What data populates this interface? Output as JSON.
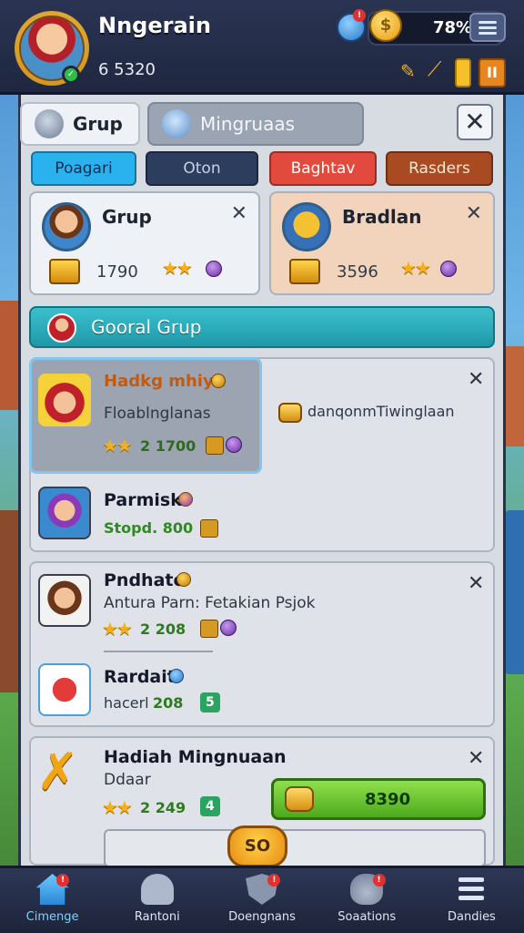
{
  "player": {
    "name": "Nngerain",
    "score": "6 5320"
  },
  "hud": {
    "gem_badge": "!",
    "coins": "78%",
    "pause": "II",
    "coin_symbol": "$"
  },
  "header": {
    "tab_grup": "Grup",
    "tab_search": "Mingruaas",
    "close": "✕"
  },
  "filters": [
    "Poagari",
    "Oton",
    "Baghtav",
    "Rasders"
  ],
  "top_cards": [
    {
      "name": "Grup",
      "score": "1790",
      "close": "✕"
    },
    {
      "name": "Bradlan",
      "score": "3596",
      "close": "✕"
    }
  ],
  "global_bar": {
    "label": "Gooral Grup"
  },
  "rows": {
    "selected": {
      "title": "Hadkg mhiyk",
      "subtitle": "Floablnglanas",
      "level": "2 1700"
    },
    "side_note": "danqonmTiwinglaan",
    "r2": {
      "title": "Parmisk",
      "status": "Stopd. 800"
    },
    "r3": {
      "title": "Pndhato",
      "subtitle": "Antura Parn: Fetakian Psjok",
      "level": "2 208"
    },
    "r4": {
      "title": "Rardait",
      "status": "hacerl",
      "num": "208",
      "tag": "5"
    },
    "r5": {
      "title": "Hadiah Mingnuaan",
      "subtitle": "Ddaar",
      "level": "2 249",
      "tag": "4"
    }
  },
  "actions": {
    "claim": "8390",
    "so_badge": "SO"
  },
  "nav": [
    {
      "label": "Cimenge",
      "icon": "home-icon",
      "badge": "!"
    },
    {
      "label": "Rantoni",
      "icon": "knight-icon",
      "badge": ""
    },
    {
      "label": "Doengnans",
      "icon": "shield-icon",
      "badge": "!"
    },
    {
      "label": "Soaations",
      "icon": "bag-icon",
      "badge": "!"
    },
    {
      "label": "Dandies",
      "icon": "menu-icon",
      "badge": ""
    }
  ],
  "colors": {
    "accent_blue": "#2ab2ee",
    "teal_bar": "#1f98a8",
    "green_button": "#4caa1e",
    "red_filter": "#e24a3e"
  }
}
